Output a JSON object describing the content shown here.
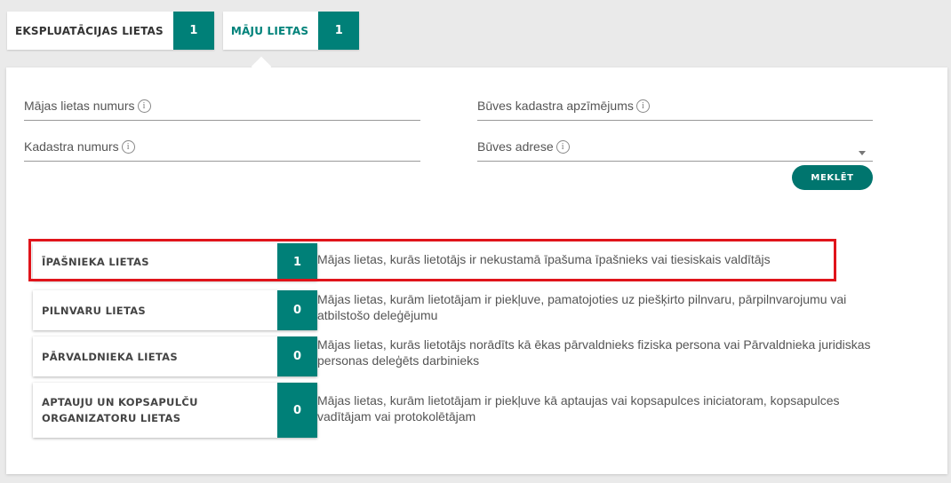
{
  "tabs": [
    {
      "label": "EKSPLUATĀCIJAS LIETAS",
      "count": "1",
      "active": false
    },
    {
      "label": "MĀJU LIETAS",
      "count": "1",
      "active": true
    }
  ],
  "filters": {
    "house_case_number": {
      "label": "Mājas lietas numurs",
      "value": ""
    },
    "building_cadastre": {
      "label": "Būves kadastra apzīmējums",
      "value": ""
    },
    "cadastre_number": {
      "label": "Kadastra numurs",
      "value": ""
    },
    "building_address": {
      "label": "Būves adrese",
      "value": ""
    },
    "info_icon": "i",
    "search_button": "MEKLĒT"
  },
  "categories": [
    {
      "label": "ĪPAŠNIEKA LIETAS",
      "count": "1",
      "description": "Mājas lietas, kurās lietotājs ir nekustamā īpašuma īpašnieks vai tiesiskais valdītājs",
      "highlighted": true
    },
    {
      "label": "PILNVARU LIETAS",
      "count": "0",
      "description": "Mājas lietas, kurām lietotājam ir piekļuve, pamatojoties uz piešķirto pilnvaru, pārpilnvarojumu vai atbilstošo deleģējumu"
    },
    {
      "label": "PĀRVALDNIEKA LIETAS",
      "count": "0",
      "description": "Mājas lietas, kurās lietotājs norādīts kā ēkas pārvaldnieks fiziska persona vai Pārvaldnieka juridiskas personas deleģēts darbinieks"
    },
    {
      "label": "APTAUJU UN KOPSAPULČU ORGANIZATORU LIETAS",
      "count": "0",
      "description": "Mājas lietas, kurām lietotājam ir piekļuve kā aptaujas vai kopsapulces iniciatoram, kopsapulces vadītājam vai protokolētājam"
    }
  ],
  "colors": {
    "accent": "#008078",
    "highlight": "#e0141b"
  }
}
